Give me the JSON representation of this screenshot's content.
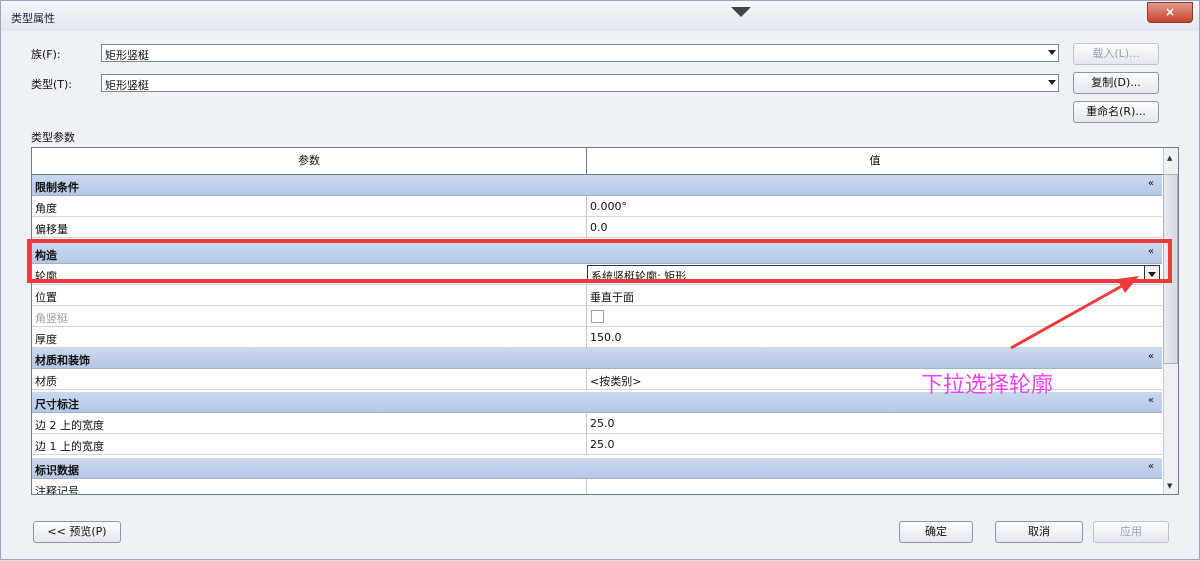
{
  "window": {
    "title": "类型属性",
    "close_label": "×"
  },
  "family": {
    "label": "族(F):",
    "value": "矩形竖梃"
  },
  "type": {
    "label": "类型(T):",
    "value": "矩形竖梃"
  },
  "buttons": {
    "load": "载入(L)...",
    "duplicate": "复制(D)...",
    "rename": "重命名(R)...",
    "preview": "<< 预览(P)",
    "ok": "确定",
    "cancel": "取消",
    "apply": "应用"
  },
  "type_params_label": "类型参数",
  "table": {
    "col_param": "参数",
    "col_value": "值",
    "collapse_icon": "«",
    "groups": [
      {
        "title": "限制条件",
        "rows": [
          {
            "name": "角度",
            "value": "0.000°"
          },
          {
            "name": "偏移量",
            "value": "0.0"
          }
        ]
      },
      {
        "title": "构造",
        "rows": [
          {
            "name": "轮廓",
            "value": "系统竖梃轮廓: 矩形"
          },
          {
            "name": "位置",
            "value": "垂直于面"
          },
          {
            "name": "角竖梃",
            "value": ""
          },
          {
            "name": "厚度",
            "value": "150.0"
          }
        ]
      },
      {
        "title": "材质和装饰",
        "rows": [
          {
            "name": "材质",
            "value": "<按类别>"
          }
        ]
      },
      {
        "title": "尺寸标注",
        "rows": [
          {
            "name": "边 2 上的宽度",
            "value": "25.0"
          },
          {
            "name": "边 1 上的宽度",
            "value": "25.0"
          }
        ]
      },
      {
        "title": "标识数据",
        "rows": [
          {
            "name": "注释记号",
            "value": ""
          }
        ]
      }
    ]
  },
  "annotation": {
    "text": "下拉选择轮廓",
    "color": "#ee44ee"
  },
  "highlight_color": "#f03a3a"
}
